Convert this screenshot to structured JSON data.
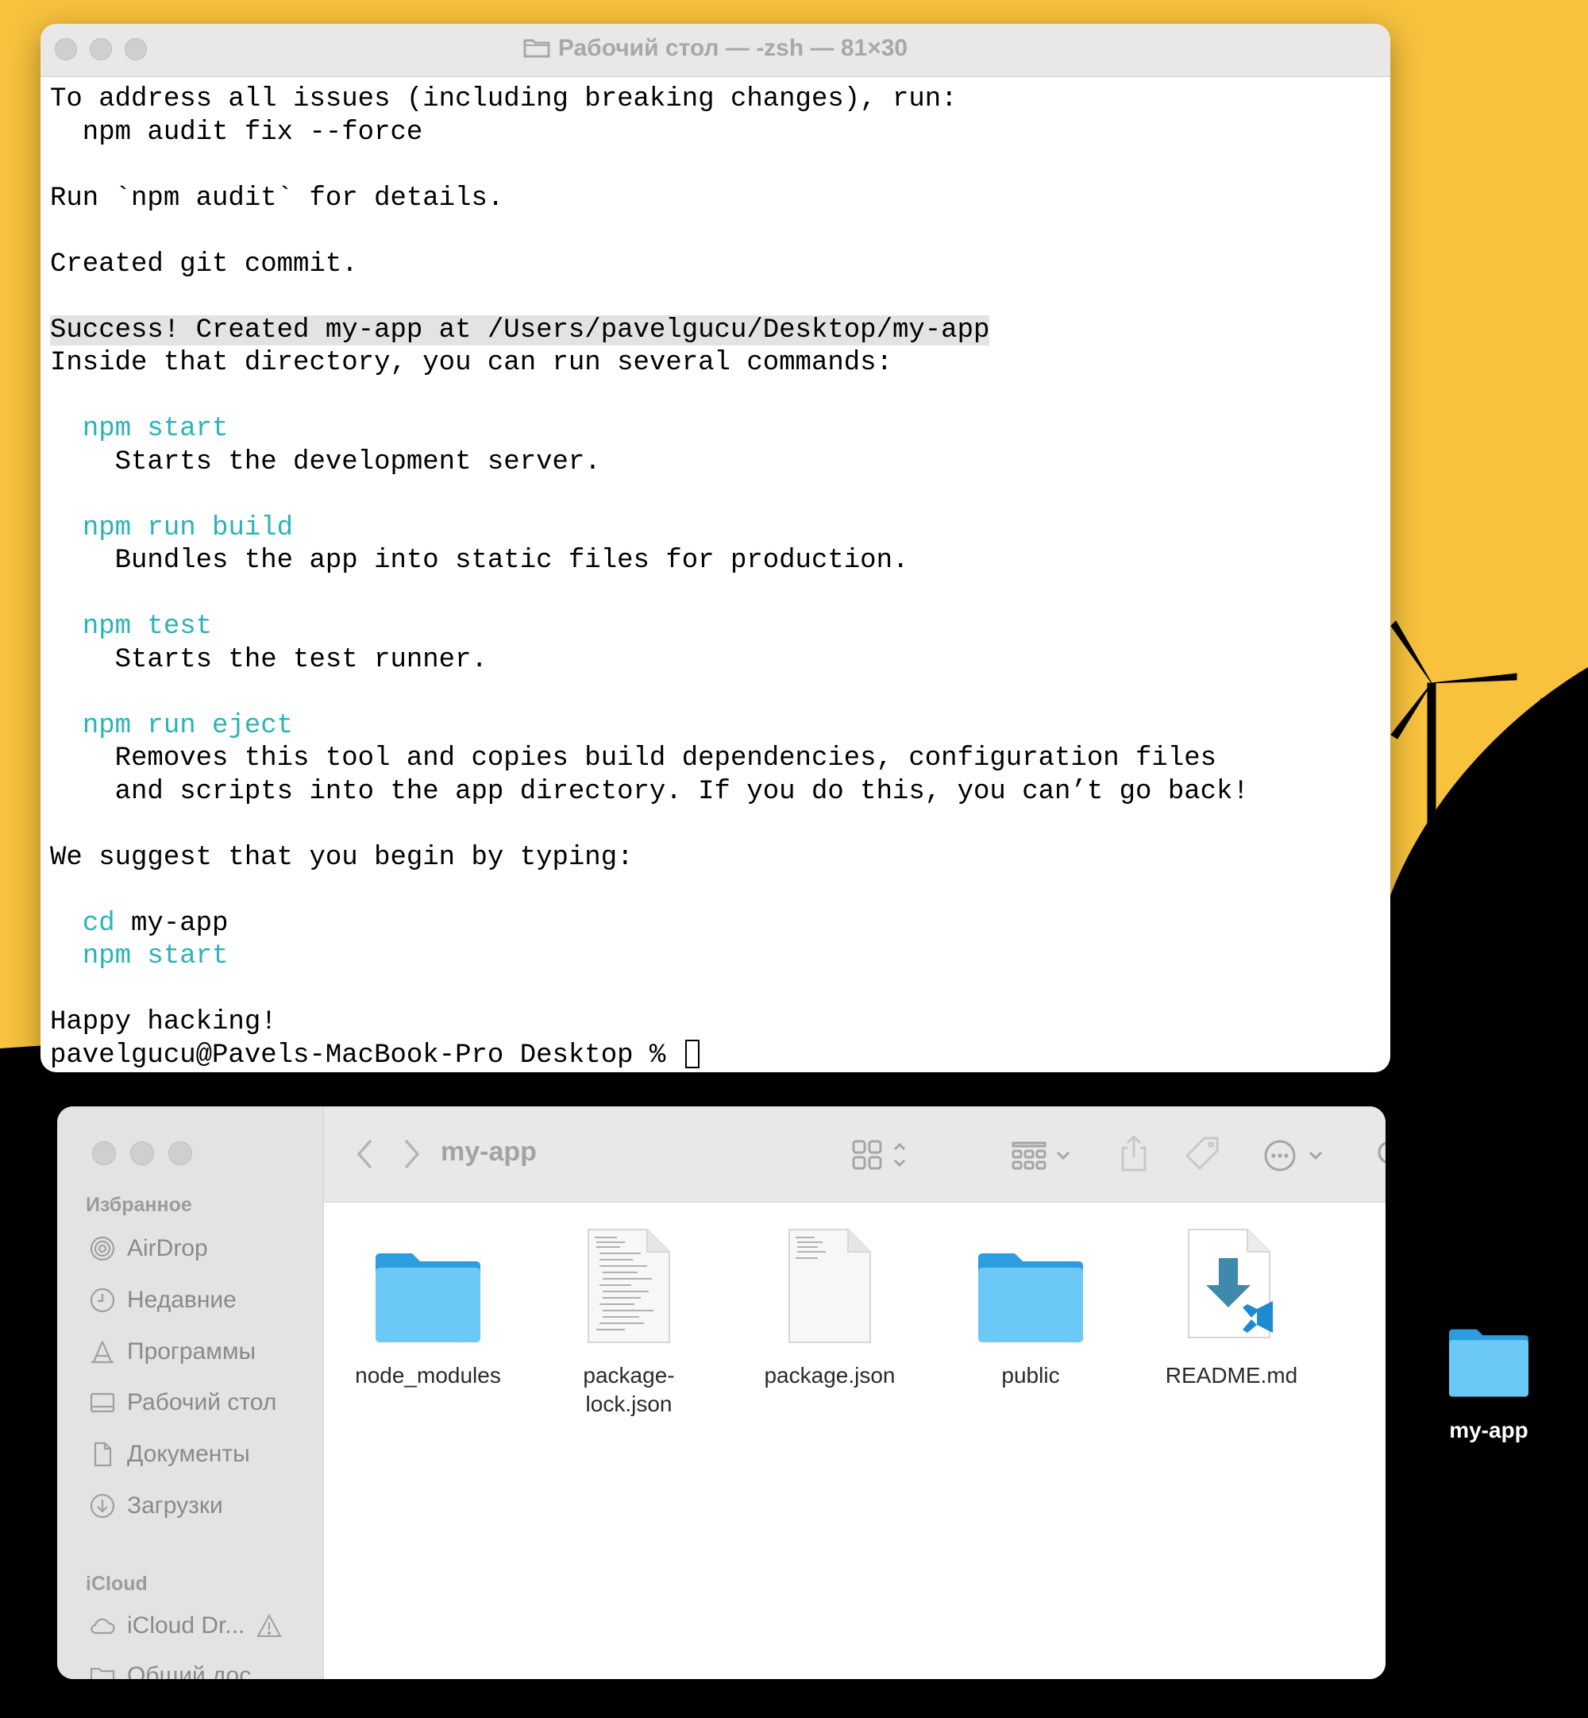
{
  "terminal": {
    "title": "Рабочий стол — -zsh — 81×30",
    "lines": [
      {
        "a": "To address all issues (including breaking changes), run:"
      },
      {
        "a": "  npm audit fix --force"
      },
      {
        "a": ""
      },
      {
        "a": "Run `npm audit` for details."
      },
      {
        "a": ""
      },
      {
        "a": "Created git commit."
      },
      {
        "a": ""
      },
      {
        "h": "Success! Created my-app at /Users/pavelgucu/Desktop/my-app"
      },
      {
        "a": "Inside that directory, you can run several commands:"
      },
      {
        "a": ""
      },
      {
        "p": "  ",
        "c": "npm start"
      },
      {
        "a": "    Starts the development server."
      },
      {
        "a": ""
      },
      {
        "p": "  ",
        "c": "npm run build"
      },
      {
        "a": "    Bundles the app into static files for production."
      },
      {
        "a": ""
      },
      {
        "p": "  ",
        "c": "npm test"
      },
      {
        "a": "    Starts the test runner."
      },
      {
        "a": ""
      },
      {
        "p": "  ",
        "c": "npm run eject"
      },
      {
        "a": "    Removes this tool and copies build dependencies, configuration files"
      },
      {
        "a": "    and scripts into the app directory. If you do this, you can’t go back!"
      },
      {
        "a": ""
      },
      {
        "a": "We suggest that you begin by typing:"
      },
      {
        "a": ""
      },
      {
        "p": "  ",
        "c": "cd",
        "r": " my-app"
      },
      {
        "p": "  ",
        "c": "npm start"
      },
      {
        "a": ""
      },
      {
        "a": "Happy hacking!"
      },
      {
        "a": "pavelgucu@Pavels-MacBook-Pro Desktop % ",
        "cursor": true
      }
    ]
  },
  "finder": {
    "title": "my-app",
    "sidebar": {
      "favorites_header": "Избранное",
      "items": [
        {
          "label": "AirDrop",
          "icon": "airdrop-icon"
        },
        {
          "label": "Недавние",
          "icon": "clock-icon"
        },
        {
          "label": "Программы",
          "icon": "applications-icon"
        },
        {
          "label": "Рабочий стол",
          "icon": "desktop-icon"
        },
        {
          "label": "Документы",
          "icon": "document-icon"
        },
        {
          "label": "Загрузки",
          "icon": "downloads-icon"
        }
      ],
      "icloud_header": "iCloud",
      "icloud_items": [
        {
          "label": "iCloud Dr...",
          "icon": "cloud-icon"
        },
        {
          "label": "Общий дос",
          "icon": "shared-folder-icon"
        }
      ]
    },
    "files": [
      {
        "name": "node_modules",
        "kind": "folder"
      },
      {
        "name": "package-\nlock.json",
        "kind": "text"
      },
      {
        "name": "package.json",
        "kind": "text"
      },
      {
        "name": "public",
        "kind": "folder"
      },
      {
        "name": "README.md",
        "kind": "markdown"
      }
    ]
  },
  "desktop": {
    "icon_label": "my-app"
  },
  "colors": {
    "terminal_cyan": "#2bb3b8",
    "folder_blue": "#5ec2f2",
    "wallpaper_yellow": "#f8c23d"
  }
}
